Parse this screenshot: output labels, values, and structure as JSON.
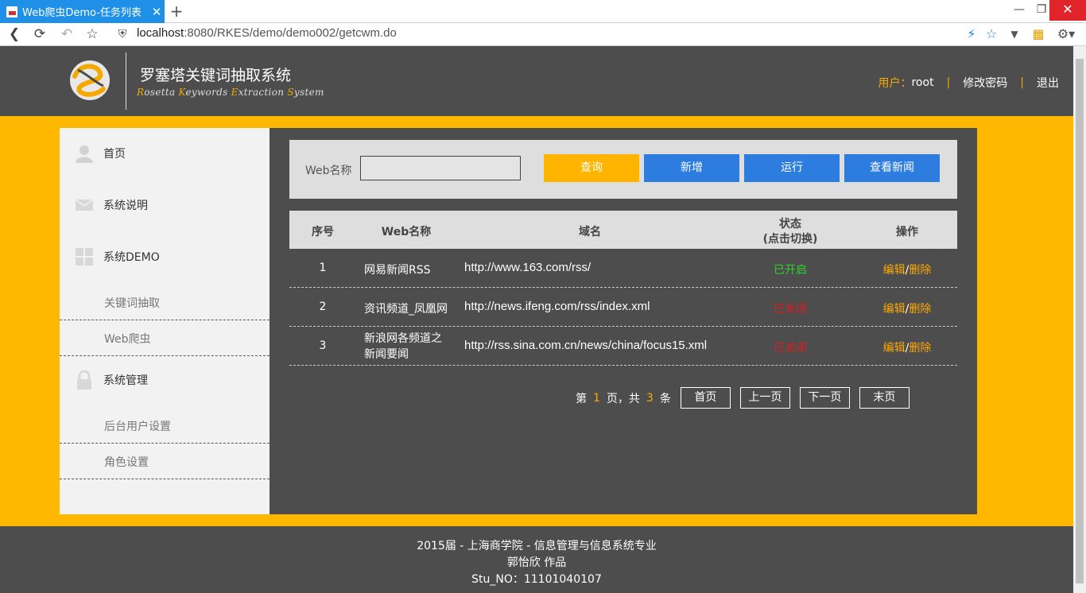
{
  "browser": {
    "tab_title": "Web爬虫Demo-任务列表",
    "tab_close": "✕",
    "newtab": "+",
    "url_host": "localhost",
    "url_rest": ":8080/RKES/demo/demo002/getcwm.do"
  },
  "header": {
    "title": "罗塞塔关键词抽取系统",
    "subtitle_parts": [
      "R",
      "osetta ",
      "K",
      "eywords ",
      "E",
      "xtraction ",
      "S",
      "ystem"
    ],
    "user_label": "用户：",
    "user_name": "root",
    "change_password": "修改密码",
    "logout": "退出",
    "separator": "|"
  },
  "sidebar": {
    "home": "首页",
    "about": "系统说明",
    "demo": "系统DEMO",
    "demo_keyword": "关键词抽取",
    "demo_crawler": "Web爬虫",
    "admin": "系统管理",
    "admin_users": "后台用户设置",
    "admin_roles": "角色设置"
  },
  "search": {
    "label": "Web名称",
    "value": "",
    "btn_query": "查询",
    "btn_add": "新增",
    "btn_run": "运行",
    "btn_news": "查看新闻"
  },
  "table": {
    "headers": {
      "idx": "序号",
      "name": "Web名称",
      "domain": "域名",
      "status_line1": "状态",
      "status_line2": "(点击切换)",
      "ops": "操作"
    },
    "rows": [
      {
        "idx": "1",
        "name": "网易新闻RSS",
        "domain": "http://www.163.com/rss/",
        "status": "已开启",
        "edit": "编辑",
        "slash": "/",
        "del": "删除"
      },
      {
        "idx": "2",
        "name": "资讯频道_凤凰网",
        "domain": "http://news.ifeng.com/rss/index.xml",
        "status": "已关闭",
        "edit": "编辑",
        "slash": "/",
        "del": "删除"
      },
      {
        "idx": "3",
        "name_line1": "新浪网各频道之",
        "name_line2": "新闻要闻",
        "domain": "http://rss.sina.com.cn/news/china/focus15.xml",
        "status": "已关闭",
        "edit": "编辑",
        "slash": "/",
        "del": "删除"
      }
    ]
  },
  "pager": {
    "prefix": "第",
    "current": "1",
    "mid": "页，共",
    "total": "3",
    "suffix": "条",
    "first": "首页",
    "prev": "上一页",
    "next": "下一页",
    "last": "末页"
  },
  "footer": {
    "line1": "2015届 - 上海商学院 - 信息管理与信息系统专业",
    "line2": "郭怡欣 作品",
    "line3": "Stu_NO：11101040107"
  },
  "colors": {
    "accent": "#ffb700",
    "button_blue": "#2d7ce0",
    "status_on": "#2ad42a",
    "status_off": "#e21a1a"
  }
}
